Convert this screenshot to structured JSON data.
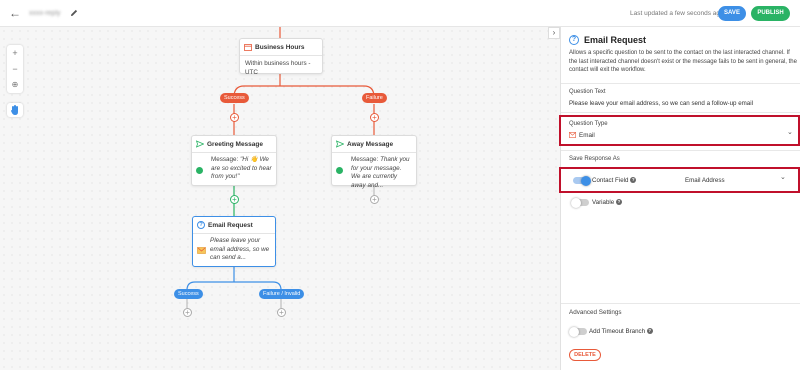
{
  "topbar": {
    "workflow_name": "xxxx-reply",
    "last_updated": "Last updated a few seconds ago",
    "save_label": "SAVE",
    "publish_label": "PUBLISH"
  },
  "canvas": {
    "zoom_in": "+",
    "zoom_out": "−",
    "collapse_arrow": "›",
    "nodes": {
      "business_hours": {
        "title": "Business Hours",
        "body": "Within business hours - UTC"
      },
      "greeting": {
        "title": "Greeting Message",
        "body_prefix": "Message: ",
        "body_italic": "\"Hi 👋 We are so excited to hear from you!\""
      },
      "away": {
        "title": "Away Message",
        "body_prefix": "Message: ",
        "body_italic": "Thank you for your message. We are currently away and..."
      },
      "email_request": {
        "title": "Email Request",
        "body": "Please leave your email address, so we can send a..."
      }
    },
    "pills": {
      "success_top": "Success",
      "failure_top": "Failure",
      "success_bottom": "Success",
      "failure_bottom": "Failure / Invalid"
    }
  },
  "panel": {
    "title": "Email Request",
    "description": "Allows a specific question to be sent to the contact on the last interacted channel. If the last interacted channel doesn't exist or the message fails to be sent in general, the contact will exit the workflow.",
    "question_text_label": "Question Text",
    "question_text_value": "Please leave your email address, so we can send a follow-up email",
    "question_type_label": "Question Type",
    "question_type_value": "Email",
    "save_response_label": "Save Response As",
    "contact_field_label": "Contact Field",
    "contact_field_value": "Email Address",
    "variable_label": "Variable",
    "advanced_label": "Advanced Settings",
    "timeout_label": "Add Timeout Branch",
    "delete_label": "DELETE"
  },
  "colors": {
    "accent_blue": "#3d8fe6",
    "publish_green": "#2ab365",
    "failure_red": "#e85a3a",
    "highlight_red": "#c0102b"
  }
}
